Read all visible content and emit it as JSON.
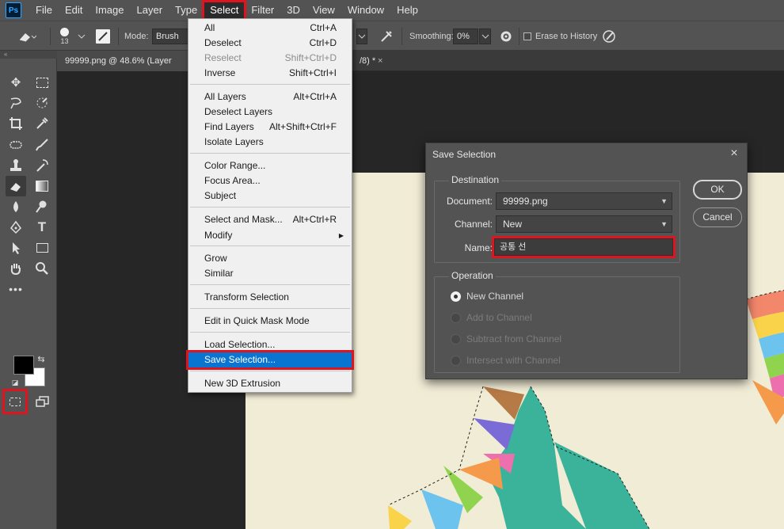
{
  "menubar": {
    "logo": "Ps",
    "items": [
      "File",
      "Edit",
      "Image",
      "Layer",
      "Type",
      "Select",
      "Filter",
      "3D",
      "View",
      "Window",
      "Help"
    ],
    "active": "Select"
  },
  "options": {
    "brush_size": "13",
    "mode_label": "Mode:",
    "mode_value": "Brush",
    "smoothing_label": "Smoothing:",
    "smoothing_value": "0%",
    "erase_history_label": "Erase to History"
  },
  "tabs": {
    "active_tab": "99999.png @ 48.6% (Layer 1,",
    "hidden_tab_fragment": "/8) *",
    "close": "×"
  },
  "select_menu": {
    "groups": [
      [
        {
          "label": "All",
          "shortcut": "Ctrl+A"
        },
        {
          "label": "Deselect",
          "shortcut": "Ctrl+D"
        },
        {
          "label": "Reselect",
          "shortcut": "Shift+Ctrl+D",
          "disabled": true
        },
        {
          "label": "Inverse",
          "shortcut": "Shift+Ctrl+I"
        }
      ],
      [
        {
          "label": "All Layers",
          "shortcut": "Alt+Ctrl+A"
        },
        {
          "label": "Deselect Layers",
          "shortcut": ""
        },
        {
          "label": "Find Layers",
          "shortcut": "Alt+Shift+Ctrl+F"
        },
        {
          "label": "Isolate Layers",
          "shortcut": ""
        }
      ],
      [
        {
          "label": "Color Range...",
          "shortcut": ""
        },
        {
          "label": "Focus Area...",
          "shortcut": ""
        },
        {
          "label": "Subject",
          "shortcut": ""
        }
      ],
      [
        {
          "label": "Select and Mask...",
          "shortcut": "Alt+Ctrl+R"
        },
        {
          "label": "Modify",
          "shortcut": "",
          "submenu": true
        }
      ],
      [
        {
          "label": "Grow",
          "shortcut": ""
        },
        {
          "label": "Similar",
          "shortcut": ""
        }
      ],
      [
        {
          "label": "Transform Selection",
          "shortcut": ""
        }
      ],
      [
        {
          "label": "Edit in Quick Mask Mode",
          "shortcut": ""
        }
      ],
      [
        {
          "label": "Load Selection...",
          "shortcut": ""
        },
        {
          "label": "Save Selection...",
          "shortcut": "",
          "highlighted": true
        }
      ],
      [
        {
          "label": "New 3D Extrusion",
          "shortcut": ""
        }
      ]
    ]
  },
  "dialog": {
    "title": "Save Selection",
    "close": "×",
    "destination_label": "Destination",
    "document_label": "Document:",
    "document_value": "99999.png",
    "channel_label": "Channel:",
    "channel_value": "New",
    "name_label": "Name:",
    "name_value": "공통 선",
    "operation_label": "Operation",
    "operations": [
      {
        "label": "New Channel",
        "checked": true,
        "enabled": true
      },
      {
        "label": "Add to Channel",
        "checked": false,
        "enabled": false
      },
      {
        "label": "Subtract from Channel",
        "checked": false,
        "enabled": false
      },
      {
        "label": "Intersect with Channel",
        "checked": false,
        "enabled": false
      }
    ],
    "ok_label": "OK",
    "cancel_label": "Cancel"
  },
  "colors": {
    "highlight_red": "#e0141e",
    "menu_highlight": "#0a74d1",
    "canvas_bg": "#f1ecd6",
    "teal": "#3bb39a"
  }
}
